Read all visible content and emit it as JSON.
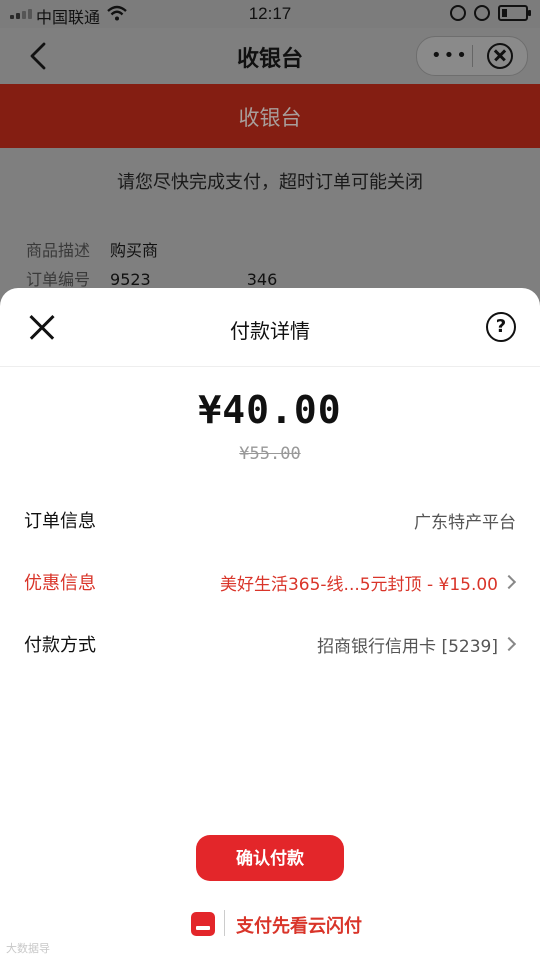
{
  "status_bar": {
    "carrier": "中国联通",
    "time": "12:17"
  },
  "nav": {
    "title": "收银台"
  },
  "banner": {
    "title": "收银台"
  },
  "notice": "请您尽快完成支付，超时订单可能关闭",
  "order_info": {
    "desc_label": "商品描述",
    "desc_value": "购买商",
    "number_label": "订单编号",
    "number_value_start": "9523",
    "number_value_end": "346"
  },
  "sheet": {
    "title": "付款详情",
    "amount": "¥40.00",
    "original_amount": "¥55.00",
    "rows": [
      {
        "label": "订单信息",
        "value": "广东特产平台"
      },
      {
        "label": "优惠信息",
        "value": "美好生活365-线...5元封顶 - ¥15.00"
      },
      {
        "label": "付款方式",
        "value": "招商银行信用卡 [5239]"
      }
    ],
    "confirm_label": "确认付款",
    "footer_slogan": "支付先看云闪付"
  },
  "watermark": "大数据导",
  "colors": {
    "banner": "#841e12",
    "accent_red": "#e3262a",
    "discount_red": "#d9352a"
  }
}
